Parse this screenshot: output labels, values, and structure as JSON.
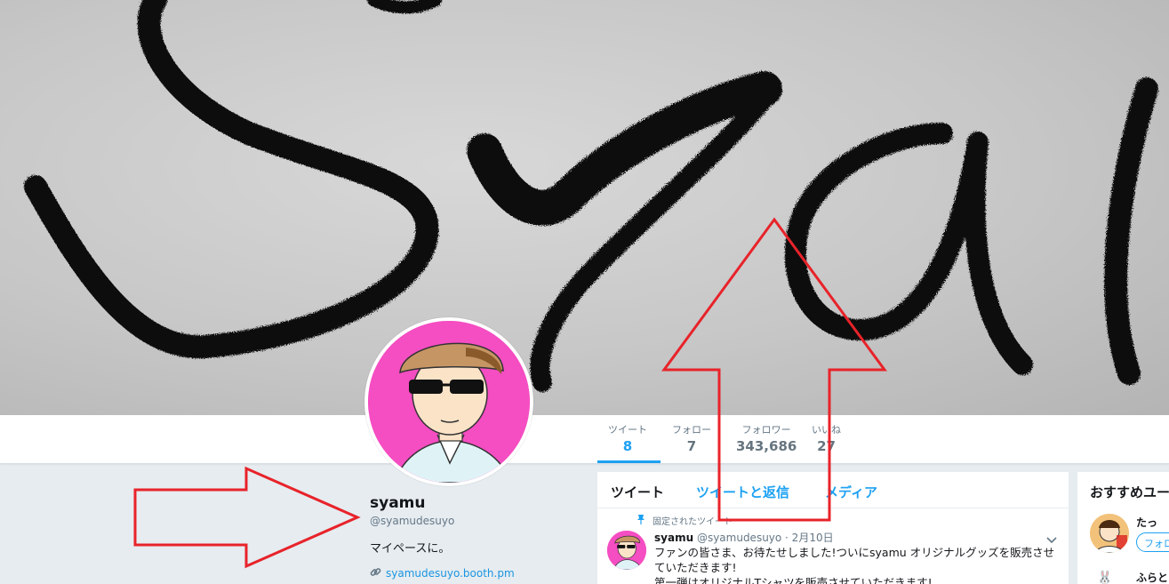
{
  "profile": {
    "name": "syamu",
    "handle": "@syamudesuyo",
    "bio": "マイペースに。",
    "link": "syamudesuyo.booth.pm"
  },
  "stats": [
    {
      "label": "ツイート",
      "value": "8"
    },
    {
      "label": "フォロー",
      "value": "7"
    },
    {
      "label": "フォロワー",
      "value": "343,686"
    },
    {
      "label": "いいね",
      "value": "27"
    }
  ],
  "timeline": {
    "tabs": [
      "ツイート",
      "ツイートと返信",
      "メディア"
    ],
    "pinned_label": "固定されたツイート",
    "tweet": {
      "name": "syamu",
      "handle_date": "@syamudesuyo · 2月10日",
      "line1": "ファンの皆さま、お待たせしました!ついにsyamu オリジナルグッズを販売させ",
      "line2": "ていただきます!",
      "line3": "第一弾はオリジナルTシャツを販売させていただきます!"
    }
  },
  "sidebar": {
    "title": "おすすめユーザー",
    "users": [
      {
        "name": "たっ",
        "follow_label": "フォロー"
      },
      {
        "name": "ふらと"
      }
    ]
  },
  "colors": {
    "accent": "#1da1f2",
    "annotation": "#e8232a",
    "avatar_bg": "#f54dc2"
  }
}
